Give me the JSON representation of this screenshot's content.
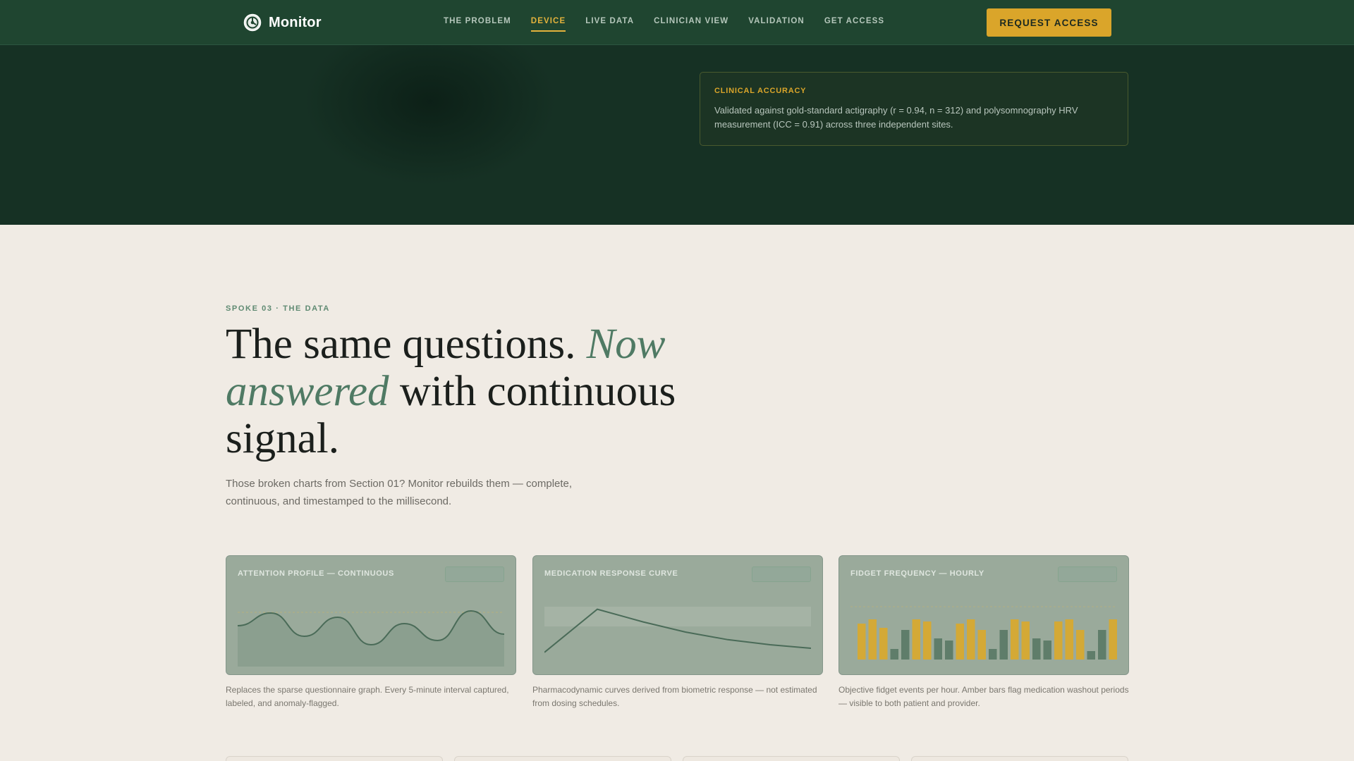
{
  "nav": {
    "brand": "Monitor",
    "links": [
      {
        "label": "THE PROBLEM"
      },
      {
        "label": "DEVICE"
      },
      {
        "label": "LIVE DATA"
      },
      {
        "label": "CLINICIAN VIEW"
      },
      {
        "label": "VALIDATION"
      },
      {
        "label": "GET ACCESS"
      }
    ],
    "active": "DEVICE",
    "cta_label": "REQUEST ACCESS"
  },
  "hero": {
    "accuracy_label": "CLINICAL ACCURACY",
    "accuracy_text": "Validated against gold-standard actigraphy (r = 0.94, n = 312) and polysomnography HRV measurement (ICC = 0.91) across three independent sites."
  },
  "section": {
    "kicker": "SPOKE 03 · THE DATA",
    "headline_part1": "The same questions. ",
    "headline_em": "Now answered",
    "headline_part2": " with continuous signal.",
    "lede": "Those broken charts from Section 01? Monitor rebuilds them — complete, continuous, and timestamped to the millisecond."
  },
  "cards": [
    {
      "title": "ATTENTION PROFILE — CONTINUOUS",
      "caption": "Replaces the sparse questionnaire graph. Every 5-minute interval captured, labeled, and anomaly-flagged."
    },
    {
      "title": "MEDICATION RESPONSE CURVE",
      "caption": "Pharmacodynamic curves derived from biometric response — not estimated from dosing schedules."
    },
    {
      "title": "FIDGET FREQUENCY — HOURLY",
      "caption": "Objective fidget events per hour. Amber bars flag medication washout periods — visible to both patient and provider."
    }
  ],
  "colors": {
    "nav_bg": "#1f4530",
    "hero_bg": "#163124",
    "accent_amber": "#daa52a",
    "accent_green": "#4f7a64",
    "page_bg": "#f0ebe4"
  },
  "chart_data": [
    {
      "type": "line",
      "series": [
        {
          "values": [
            0.55,
            0.85,
            0.3,
            0.75,
            0.1,
            0.6,
            0.2,
            0.9,
            0.35
          ]
        }
      ]
    },
    {
      "type": "line",
      "series": [
        {
          "values": [
            0.1,
            0.95,
            0.7,
            0.5,
            0.35,
            0.25,
            0.18
          ]
        }
      ]
    },
    {
      "type": "bar",
      "series": [
        {
          "values": [
            0.85,
            0.95,
            0.75,
            0.25,
            0.7,
            0.95,
            0.9,
            0.5,
            0.45,
            0.85,
            0.95,
            0.7,
            0.25,
            0.7,
            0.95,
            0.9,
            0.5,
            0.45,
            0.9,
            0.95,
            0.7,
            0.2,
            0.7,
            0.95
          ]
        }
      ],
      "amber": [
        true,
        true,
        true,
        false,
        false,
        true,
        true,
        false,
        false,
        true,
        true,
        true,
        false,
        false,
        true,
        true,
        false,
        false,
        true,
        true,
        true,
        false,
        false,
        true
      ]
    }
  ]
}
